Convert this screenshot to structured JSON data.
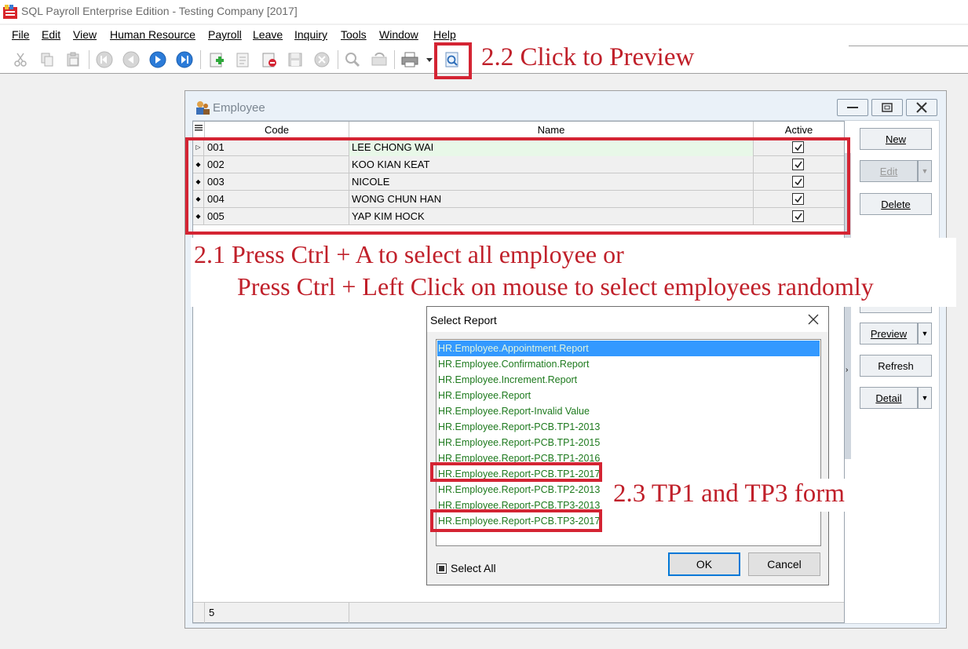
{
  "window": {
    "title": "SQL Payroll Enterprise Edition - Testing Company [2017]"
  },
  "menu": [
    {
      "label": "File"
    },
    {
      "label": "Edit"
    },
    {
      "label": "View"
    },
    {
      "label": "Human Resource"
    },
    {
      "label": "Payroll"
    },
    {
      "label": "Leave"
    },
    {
      "label": "Inquiry"
    },
    {
      "label": "Tools"
    },
    {
      "label": "Window"
    },
    {
      "label": "Help"
    }
  ],
  "toolbar_icons": [
    "cut-icon",
    "copy-icon",
    "paste-icon",
    "first-record-icon",
    "prior-record-icon",
    "next-record-icon",
    "last-record-icon",
    "add-icon",
    "edit-icon",
    "delete-icon",
    "save-icon",
    "cancel-icon",
    "find-icon",
    "refresh-icon",
    "print-icon",
    "print-dropdown-icon",
    "preview-icon"
  ],
  "annotations": {
    "step_2_2": "2.2 Click to Preview",
    "step_2_1_line1": "2.1 Press Ctrl + A to select all employee or",
    "step_2_1_line2": "Press Ctrl + Left Click on mouse to select employees randomly",
    "step_2_3": "2.3 TP1 and TP3 form"
  },
  "employee_window": {
    "title": "Employee",
    "columns": {
      "code": "Code",
      "name": "Name",
      "active": "Active"
    },
    "rows": [
      {
        "code": "001",
        "name": "LEE CHONG WAI",
        "active": true
      },
      {
        "code": "002",
        "name": "KOO KIAN KEAT",
        "active": true
      },
      {
        "code": "003",
        "name": "NICOLE",
        "active": true
      },
      {
        "code": "004",
        "name": "WONG CHUN HAN",
        "active": true
      },
      {
        "code": "005",
        "name": "YAP KIM HOCK",
        "active": true
      }
    ],
    "footer_count": "5",
    "buttons": {
      "new": "New",
      "edit": "Edit",
      "delete": "Delete",
      "preview": "Preview",
      "refresh": "Refresh",
      "detail": "Detail"
    }
  },
  "select_report": {
    "title": "Select Report",
    "reports": [
      "HR.Employee.Appointment.Report",
      "HR.Employee.Confirmation.Report",
      "HR.Employee.Increment.Report",
      "HR.Employee.Report",
      "HR.Employee.Report-Invalid Value",
      "HR.Employee.Report-PCB.TP1-2013",
      "HR.Employee.Report-PCB.TP1-2015",
      "HR.Employee.Report-PCB.TP1-2016",
      "HR.Employee.Report-PCB.TP1-2017",
      "HR.Employee.Report-PCB.TP2-2013",
      "HR.Employee.Report-PCB.TP3-2013",
      "HR.Employee.Report-PCB.TP3-2017"
    ],
    "selected_index": 0,
    "select_all_label": "Select All",
    "ok_label": "OK",
    "cancel_label": "Cancel"
  }
}
